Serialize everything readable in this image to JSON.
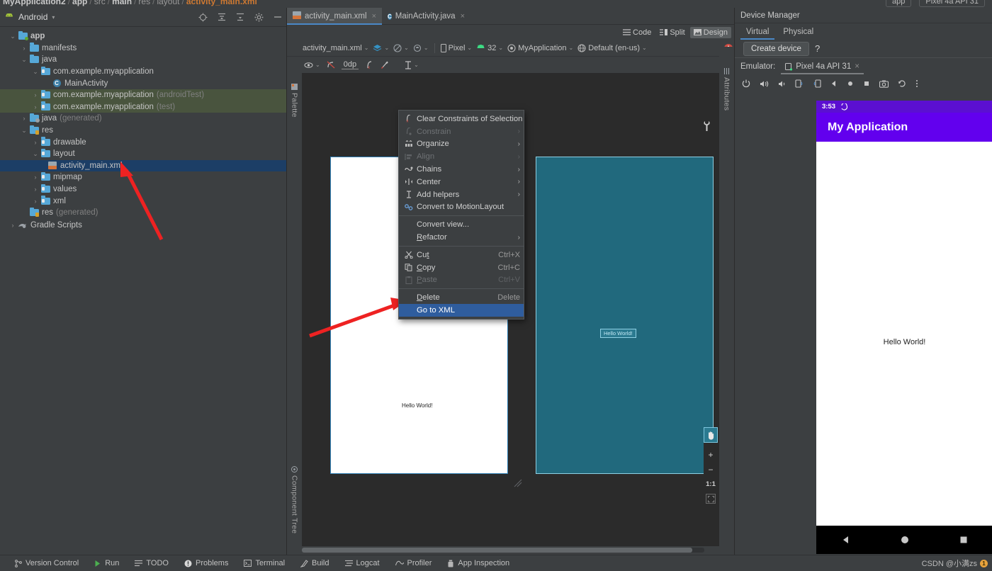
{
  "breadcrumb": {
    "items": [
      "MyApplication2",
      "app",
      "src",
      "main",
      "res",
      "layout",
      "activity_main.xml"
    ],
    "separator": "/"
  },
  "top_right_toolbar": {
    "module": "app",
    "device": "Pixel 4a API 31"
  },
  "project_panel": {
    "title": "Android",
    "dropdown_caret": "▾",
    "header_icons": [
      "target-icon",
      "collapse-all-icon",
      "expand-all-icon",
      "gear-icon",
      "minimize-icon"
    ],
    "tree": [
      {
        "label": "app",
        "indent": 0,
        "arrow": "v",
        "icon": "folder-module",
        "bold": true,
        "muted": ""
      },
      {
        "label": "manifests",
        "indent": 1,
        "arrow": ">",
        "icon": "folder",
        "bold": false,
        "muted": ""
      },
      {
        "label": "java",
        "indent": 1,
        "arrow": "v",
        "icon": "folder",
        "bold": false,
        "muted": ""
      },
      {
        "label": "com.example.myapplication",
        "indent": 2,
        "arrow": "v",
        "icon": "folder-src",
        "bold": false,
        "muted": ""
      },
      {
        "label": "MainActivity",
        "indent": 3,
        "arrow": "",
        "icon": "class",
        "bold": false,
        "muted": ""
      },
      {
        "label": "com.example.myapplication",
        "indent": 2,
        "arrow": ">",
        "icon": "folder-src",
        "bold": false,
        "muted": "(androidTest)",
        "highlight": "test"
      },
      {
        "label": "com.example.myapplication",
        "indent": 2,
        "arrow": ">",
        "icon": "folder-src",
        "bold": false,
        "muted": "(test)",
        "highlight": "test"
      },
      {
        "label": "java",
        "indent": 1,
        "arrow": ">",
        "icon": "folder-gen",
        "bold": false,
        "muted": "(generated)"
      },
      {
        "label": "res",
        "indent": 1,
        "arrow": "v",
        "icon": "folder-res",
        "bold": false,
        "muted": ""
      },
      {
        "label": "drawable",
        "indent": 2,
        "arrow": ">",
        "icon": "folder-src",
        "bold": false,
        "muted": ""
      },
      {
        "label": "layout",
        "indent": 2,
        "arrow": "v",
        "icon": "folder-src",
        "bold": false,
        "muted": ""
      },
      {
        "label": "activity_main.xml",
        "indent": 3,
        "arrow": "",
        "icon": "xml",
        "bold": false,
        "muted": "",
        "selected": true
      },
      {
        "label": "mipmap",
        "indent": 2,
        "arrow": ">",
        "icon": "folder-src",
        "bold": false,
        "muted": ""
      },
      {
        "label": "values",
        "indent": 2,
        "arrow": ">",
        "icon": "folder-src",
        "bold": false,
        "muted": ""
      },
      {
        "label": "xml",
        "indent": 2,
        "arrow": ">",
        "icon": "folder-src",
        "bold": false,
        "muted": ""
      },
      {
        "label": "res",
        "indent": 1,
        "arrow": "",
        "icon": "folder-res",
        "bold": false,
        "muted": "(generated)"
      },
      {
        "label": "Gradle Scripts",
        "indent": 0,
        "arrow": ">",
        "icon": "gradle",
        "bold": false,
        "muted": ""
      }
    ]
  },
  "editor": {
    "tabs": [
      {
        "label": "activity_main.xml",
        "icon": "xml-file-icon",
        "active": true,
        "close": "×"
      },
      {
        "label": "MainActivity.java",
        "icon": "class-file-icon",
        "active": false,
        "close": "×"
      }
    ],
    "view_modes": [
      {
        "label": "Code",
        "icon": "code-icon",
        "active": false
      },
      {
        "label": "Split",
        "icon": "split-icon",
        "active": false
      },
      {
        "label": "Design",
        "icon": "design-icon",
        "active": true
      }
    ],
    "toolbar_row1": {
      "file": "activity_main.xml",
      "device": "Pixel",
      "api": "32",
      "theme": "MyApplication",
      "locale": "Default (en-us)",
      "error_badge": "!",
      "icons": [
        "design-surface-icon",
        "blueprint-icon",
        "orientation-icon",
        "device-icon",
        "android-icon",
        "theme-icon",
        "locale-icon"
      ]
    },
    "toolbar_row2": {
      "margin": "0dp",
      "icons": [
        "eye-icon",
        "constraints-off-icon",
        "clear-constraints-icon",
        "infer-constraints-icon",
        "guideline-icon"
      ],
      "help_badge": "?"
    },
    "left_strip_label": "Palette",
    "left_strip_label_bottom": "Component Tree",
    "right_strip_label": "Attributes",
    "preview": {
      "white_device_text": "Hello World!",
      "blueprint_device_text": "Hello World!",
      "wrench_icon": "wrench-icon"
    },
    "zoom_controls": {
      "pan": "pan-hand-icon",
      "zoom_in": "+",
      "zoom_out": "−",
      "actual_size": "1:1",
      "zoom_to_fit": "fit-icon"
    }
  },
  "context_menu": {
    "items": [
      {
        "label": "Clear Constraints of Selection",
        "icon": "clear-constraints-icon",
        "accel": "",
        "submenu": false,
        "disabled": false
      },
      {
        "label": "Constrain",
        "icon": "constrain-icon",
        "accel": "",
        "submenu": true,
        "disabled": true
      },
      {
        "label": "Organize",
        "icon": "organize-icon",
        "accel": "",
        "submenu": true,
        "disabled": false
      },
      {
        "label": "Align",
        "icon": "align-icon",
        "accel": "",
        "submenu": true,
        "disabled": true
      },
      {
        "label": "Chains",
        "icon": "chains-icon",
        "accel": "",
        "submenu": true,
        "disabled": false
      },
      {
        "label": "Center",
        "icon": "center-icon",
        "accel": "",
        "submenu": true,
        "disabled": false
      },
      {
        "label": "Add helpers",
        "icon": "add-helpers-icon",
        "accel": "",
        "submenu": true,
        "disabled": false
      },
      {
        "label": "Convert to MotionLayout",
        "icon": "motion-layout-icon",
        "accel": "",
        "submenu": false,
        "disabled": false
      },
      {
        "separator": true
      },
      {
        "label": "Convert view...",
        "icon": "",
        "accel": "",
        "submenu": false,
        "disabled": false
      },
      {
        "label": "Refactor",
        "icon": "",
        "accel": "",
        "submenu": true,
        "disabled": false,
        "mnemonic": "R"
      },
      {
        "separator": true
      },
      {
        "label": "Cut",
        "icon": "cut-icon",
        "accel": "Ctrl+X",
        "submenu": false,
        "disabled": false,
        "mnemonic": "t"
      },
      {
        "label": "Copy",
        "icon": "copy-icon",
        "accel": "Ctrl+C",
        "submenu": false,
        "disabled": false,
        "mnemonic": "C"
      },
      {
        "label": "Paste",
        "icon": "paste-icon",
        "accel": "Ctrl+V",
        "submenu": false,
        "disabled": true,
        "mnemonic": "P"
      },
      {
        "separator": true
      },
      {
        "label": "Delete",
        "icon": "",
        "accel": "Delete",
        "submenu": false,
        "disabled": false,
        "mnemonic": "D"
      },
      {
        "label": "Go to XML",
        "icon": "",
        "accel": "",
        "submenu": false,
        "disabled": false,
        "highlighted": true
      }
    ]
  },
  "device_manager": {
    "title": "Device Manager",
    "tabs": [
      {
        "label": "Virtual",
        "active": true
      },
      {
        "label": "Physical",
        "active": false
      }
    ],
    "create_device_label": "Create device",
    "help_label": "?",
    "emulator_label": "Emulator:",
    "emulator_tab": "Pixel 4a API 31",
    "emulator_tab_close": "×",
    "toolbar_icons": [
      "power-icon",
      "volume-up-icon",
      "volume-down-icon",
      "rotate-left-icon",
      "rotate-right-icon",
      "back-icon",
      "home-icon",
      "overview-icon",
      "screenshot-icon",
      "history-icon",
      "more-icon"
    ],
    "screen": {
      "status_time": "3:53",
      "status_icon": "sync-icon",
      "app_bar_title": "My Application",
      "content_text": "Hello World!",
      "nav_back": "back-triangle-icon",
      "nav_home": "home-circle-icon",
      "nav_recents": "recents-square-icon"
    }
  },
  "status_bar": {
    "items": [
      {
        "label": "Version Control",
        "icon": "branch-icon"
      },
      {
        "label": "Run",
        "icon": "run-icon"
      },
      {
        "label": "TODO",
        "icon": "todo-icon"
      },
      {
        "label": "Problems",
        "icon": "problems-icon"
      },
      {
        "label": "Terminal",
        "icon": "terminal-icon"
      },
      {
        "label": "Build",
        "icon": "build-icon"
      },
      {
        "label": "Logcat",
        "icon": "logcat-icon"
      },
      {
        "label": "Profiler",
        "icon": "profiler-icon"
      },
      {
        "label": "App Inspection",
        "icon": "app-inspection-icon"
      }
    ],
    "watermark": "CSDN @小满zs",
    "watermark_badge": "1"
  },
  "colors": {
    "accent_blue": "#4a88c7",
    "selection_blue": "#1c3e66",
    "menu_highlight": "#2f5d9e",
    "blueprint_teal": "#21697d",
    "app_purple": "#6200ee",
    "annotation_red": "#ee2222"
  }
}
